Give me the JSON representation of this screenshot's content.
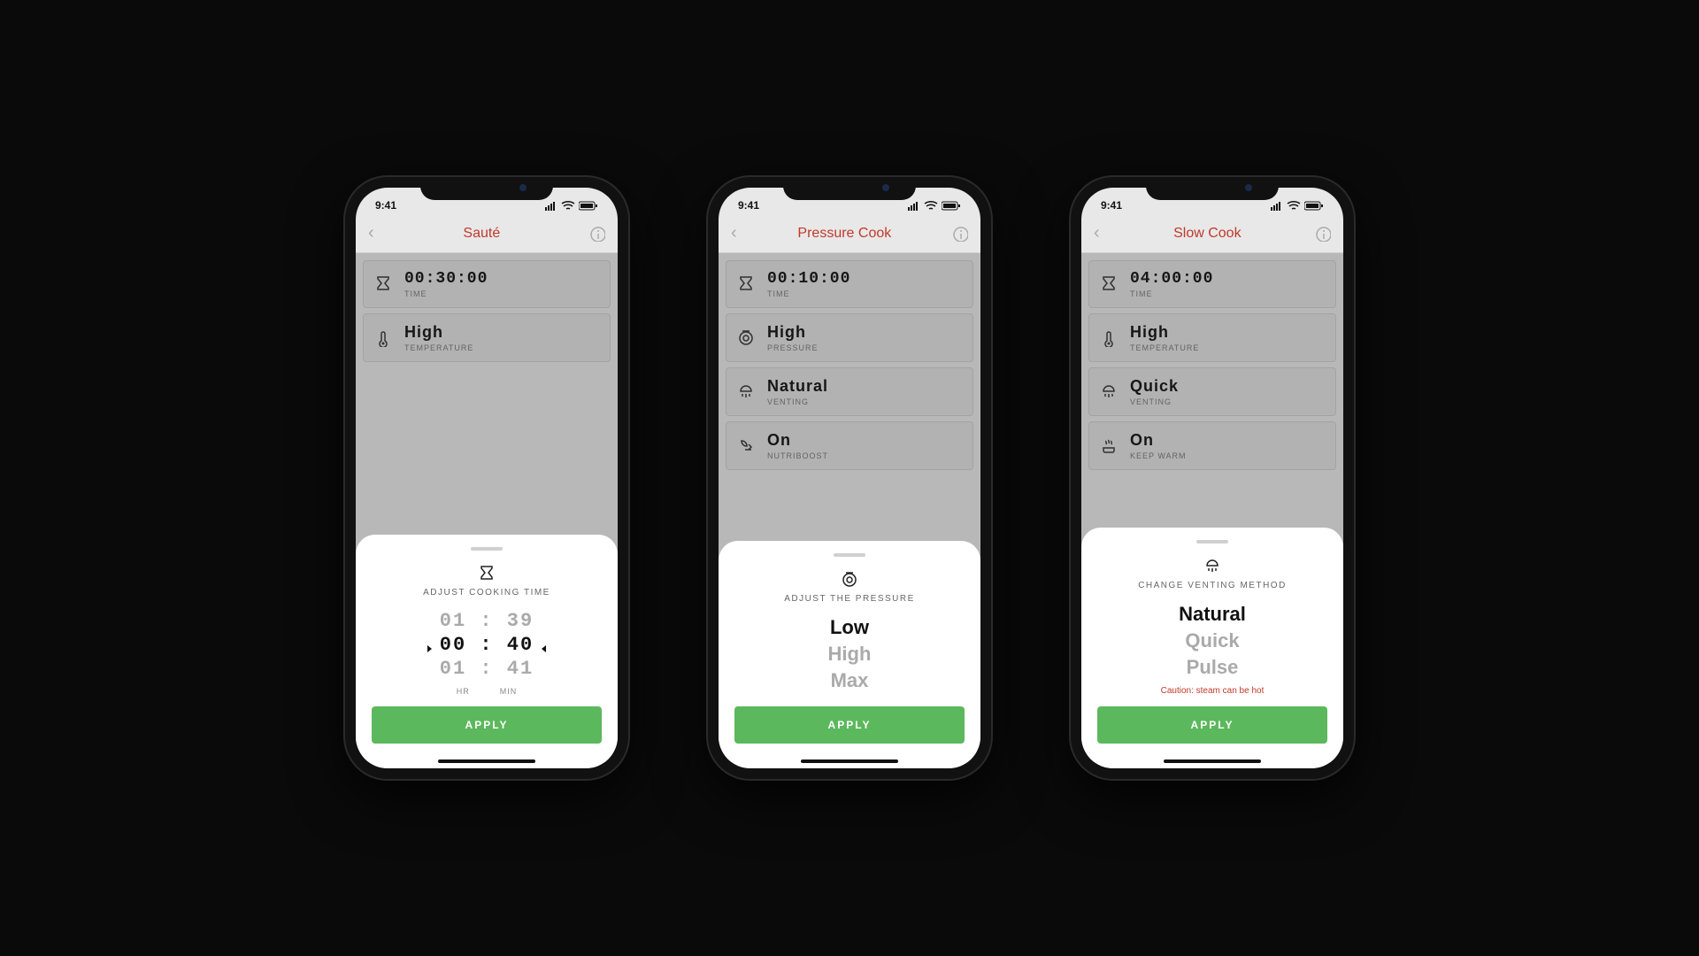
{
  "status": {
    "time": "9:41"
  },
  "common": {
    "apply_label": "APPLY"
  },
  "phones": [
    {
      "title": "Sauté",
      "settings": [
        {
          "icon": "hourglass",
          "value": "00:30:00",
          "label": "TIME",
          "mono": true
        },
        {
          "icon": "thermometer",
          "value": "High",
          "label": "TEMPERATURE"
        }
      ],
      "sheet": {
        "type": "time",
        "icon": "hourglass",
        "title": "ADJUST COOKING TIME",
        "rows": [
          "01 : 39",
          "00 : 40",
          "01 : 41"
        ],
        "selected_index": 1,
        "unit_labels": [
          "HR",
          "MIN"
        ]
      }
    },
    {
      "title": "Pressure Cook",
      "settings": [
        {
          "icon": "hourglass",
          "value": "00:10:00",
          "label": "TIME",
          "mono": true
        },
        {
          "icon": "pressure",
          "value": "High",
          "label": "PRESSURE"
        },
        {
          "icon": "vent",
          "value": "Natural",
          "label": "VENTING"
        },
        {
          "icon": "nutri",
          "value": "On",
          "label": "NUTRIBOOST"
        }
      ],
      "sheet": {
        "type": "options",
        "icon": "pressure",
        "title": "ADJUST THE PRESSURE",
        "options": [
          "Low",
          "High",
          "Max"
        ],
        "selected_index": 0
      }
    },
    {
      "title": "Slow Cook",
      "settings": [
        {
          "icon": "hourglass",
          "value": "04:00:00",
          "label": "TIME",
          "mono": true
        },
        {
          "icon": "thermometer",
          "value": "High",
          "label": "TEMPERATURE"
        },
        {
          "icon": "vent",
          "value": "Quick",
          "label": "VENTING"
        },
        {
          "icon": "keepwarm",
          "value": "On",
          "label": "KEEP WARM"
        }
      ],
      "sheet": {
        "type": "options",
        "icon": "vent",
        "title": "CHANGE VENTING METHOD",
        "options": [
          "Natural",
          "Quick",
          "Pulse"
        ],
        "selected_index": 0,
        "caution": "Caution: steam can be hot"
      }
    }
  ]
}
